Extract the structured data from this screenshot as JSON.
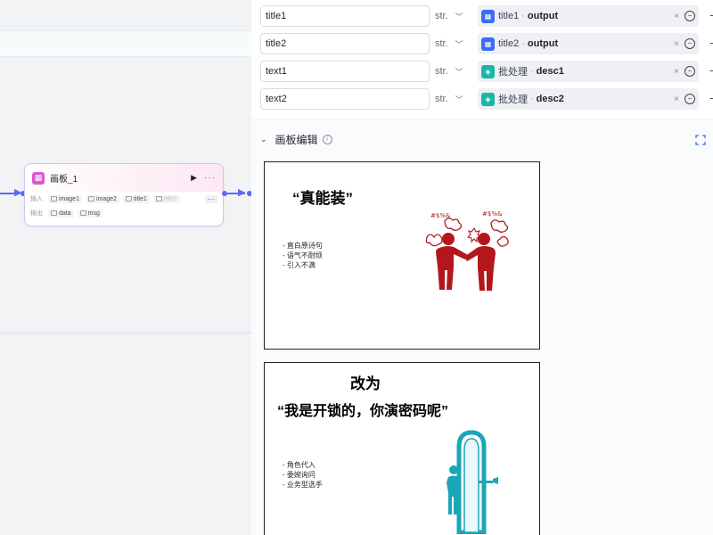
{
  "node": {
    "title": "画板_1",
    "input_label": "输入",
    "output_label": "输出",
    "inputs": [
      "image1",
      "image2",
      "title1",
      "title2"
    ],
    "outputs": [
      "data",
      "msg"
    ],
    "more": "···",
    "small_more": "···",
    "run": "▶"
  },
  "params": [
    {
      "name": "title1",
      "type": "str.",
      "source": "title1",
      "field": "output",
      "icon": "blue"
    },
    {
      "name": "title2",
      "type": "str.",
      "source": "title2",
      "field": "output",
      "icon": "blue"
    },
    {
      "name": "text1",
      "type": "str.",
      "source": "批处理",
      "field": "desc1",
      "icon": "teal"
    },
    {
      "name": "text2",
      "type": "str.",
      "source": "批处理",
      "field": "desc2",
      "icon": "teal"
    }
  ],
  "ref_separator": "·",
  "clear_glyph": "×",
  "section": {
    "title": "画板编辑",
    "chevron": "⌄",
    "info": "i"
  },
  "slide1": {
    "title": "“真能装”",
    "bullets": [
      "- 直白原诗句",
      "- 语气不耐烦",
      "- 引入不满"
    ],
    "figure_label": "#$%&"
  },
  "slide2": {
    "heading": "改为",
    "title": "“我是开锁的，你演密码呢”",
    "bullets": [
      "- 角色代入",
      "- 委婉询问",
      "- 业务型选手"
    ]
  },
  "colors": {
    "accent": "#5b6bf0",
    "node_border": "#c9c9f3",
    "node_icon": "#d85ad0",
    "ref_blue": "#3b6cf6",
    "ref_teal": "#18b8a5",
    "figure_red": "#b3171c",
    "figure_teal": "#1aa6b7"
  }
}
